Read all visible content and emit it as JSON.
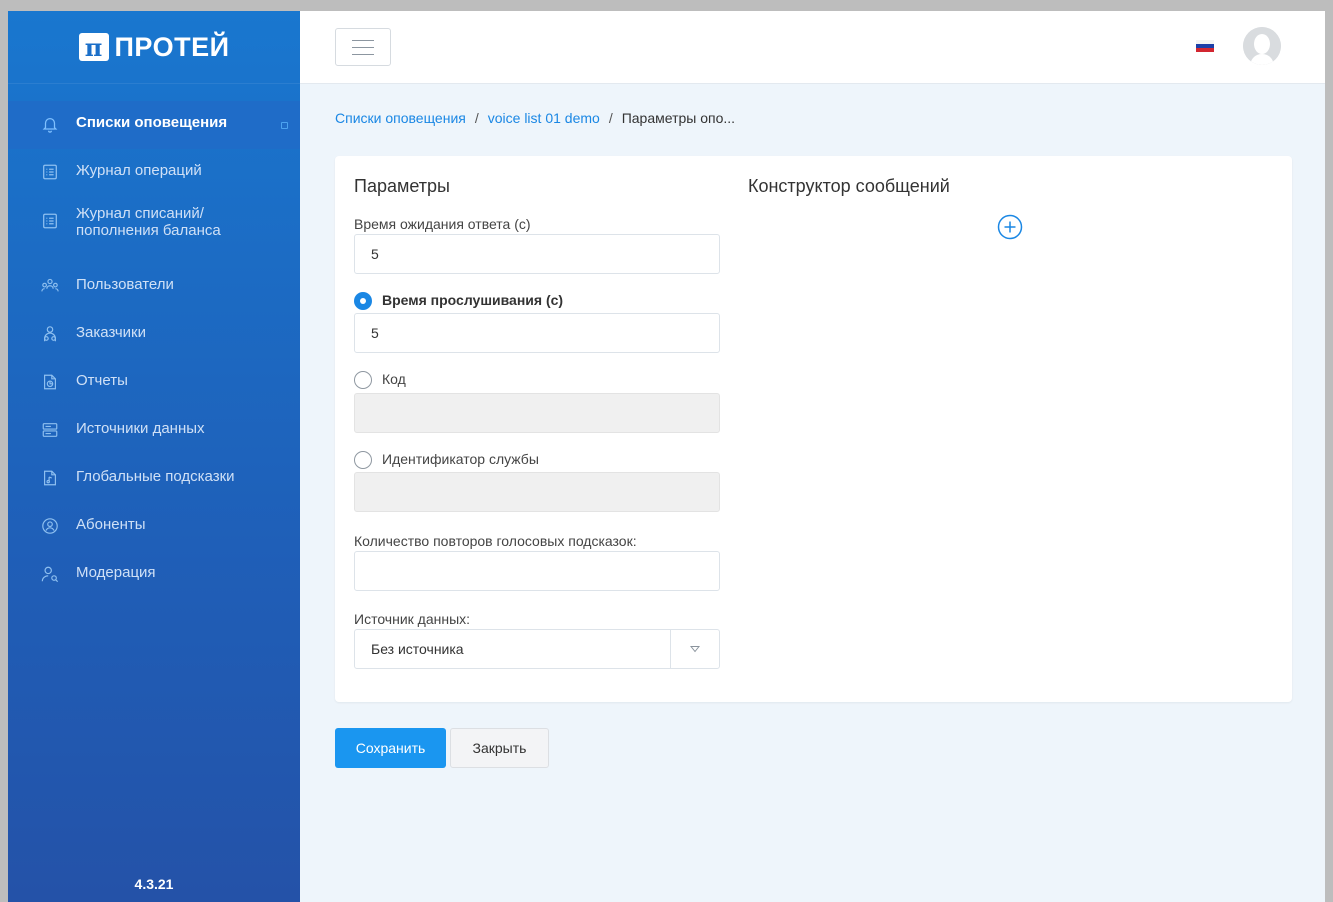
{
  "brand": {
    "logo_mark": "π",
    "name": "ПРОТЕЙ"
  },
  "sidebar": {
    "items": [
      {
        "label": "Списки оповещения",
        "icon": "bell-icon",
        "active": true
      },
      {
        "label": "Журнал операций",
        "icon": "list-document-icon"
      },
      {
        "label": "Журнал списаний/ пополнения баланса",
        "icon": "list-document-icon"
      },
      {
        "label": "Пользователи",
        "icon": "users-icon"
      },
      {
        "label": "Заказчики",
        "icon": "customers-icon"
      },
      {
        "label": "Отчеты",
        "icon": "report-file-icon"
      },
      {
        "label": "Источники данных",
        "icon": "server-icon"
      },
      {
        "label": "Глобальные подсказки",
        "icon": "audio-file-icon"
      },
      {
        "label": "Абоненты",
        "icon": "user-circle-icon"
      },
      {
        "label": "Модерация",
        "icon": "user-search-icon"
      }
    ],
    "version": "4.3.21"
  },
  "topbar": {
    "language": "ru",
    "flag_colors": [
      "#ffffff",
      "#1c3fa8",
      "#d22630"
    ]
  },
  "breadcrumb": {
    "items": [
      "Списки оповещения",
      "voice list 01 demo",
      "Параметры опо..."
    ],
    "separator": "/"
  },
  "form": {
    "params_title": "Параметры",
    "constructor_title": "Конструктор сообщений",
    "wait_time_label": "Время ожидания ответа (с)",
    "wait_time_value": "5",
    "listen_time_label": "Время прослушивания (с)",
    "listen_time_value": "5",
    "listen_time_selected": true,
    "code_label": "Код",
    "code_value": "",
    "service_id_label": "Идентификатор службы",
    "service_id_value": "",
    "repeat_label": "Количество повторов голосовых подсказок:",
    "repeat_value": "",
    "source_label": "Источник данных:",
    "source_value": "Без источника"
  },
  "actions": {
    "save": "Сохранить",
    "close": "Закрыть"
  },
  "colors": {
    "accent": "#1a87e4",
    "sidebar": "#1f5fb8",
    "primary_button": "#1a96f0"
  }
}
